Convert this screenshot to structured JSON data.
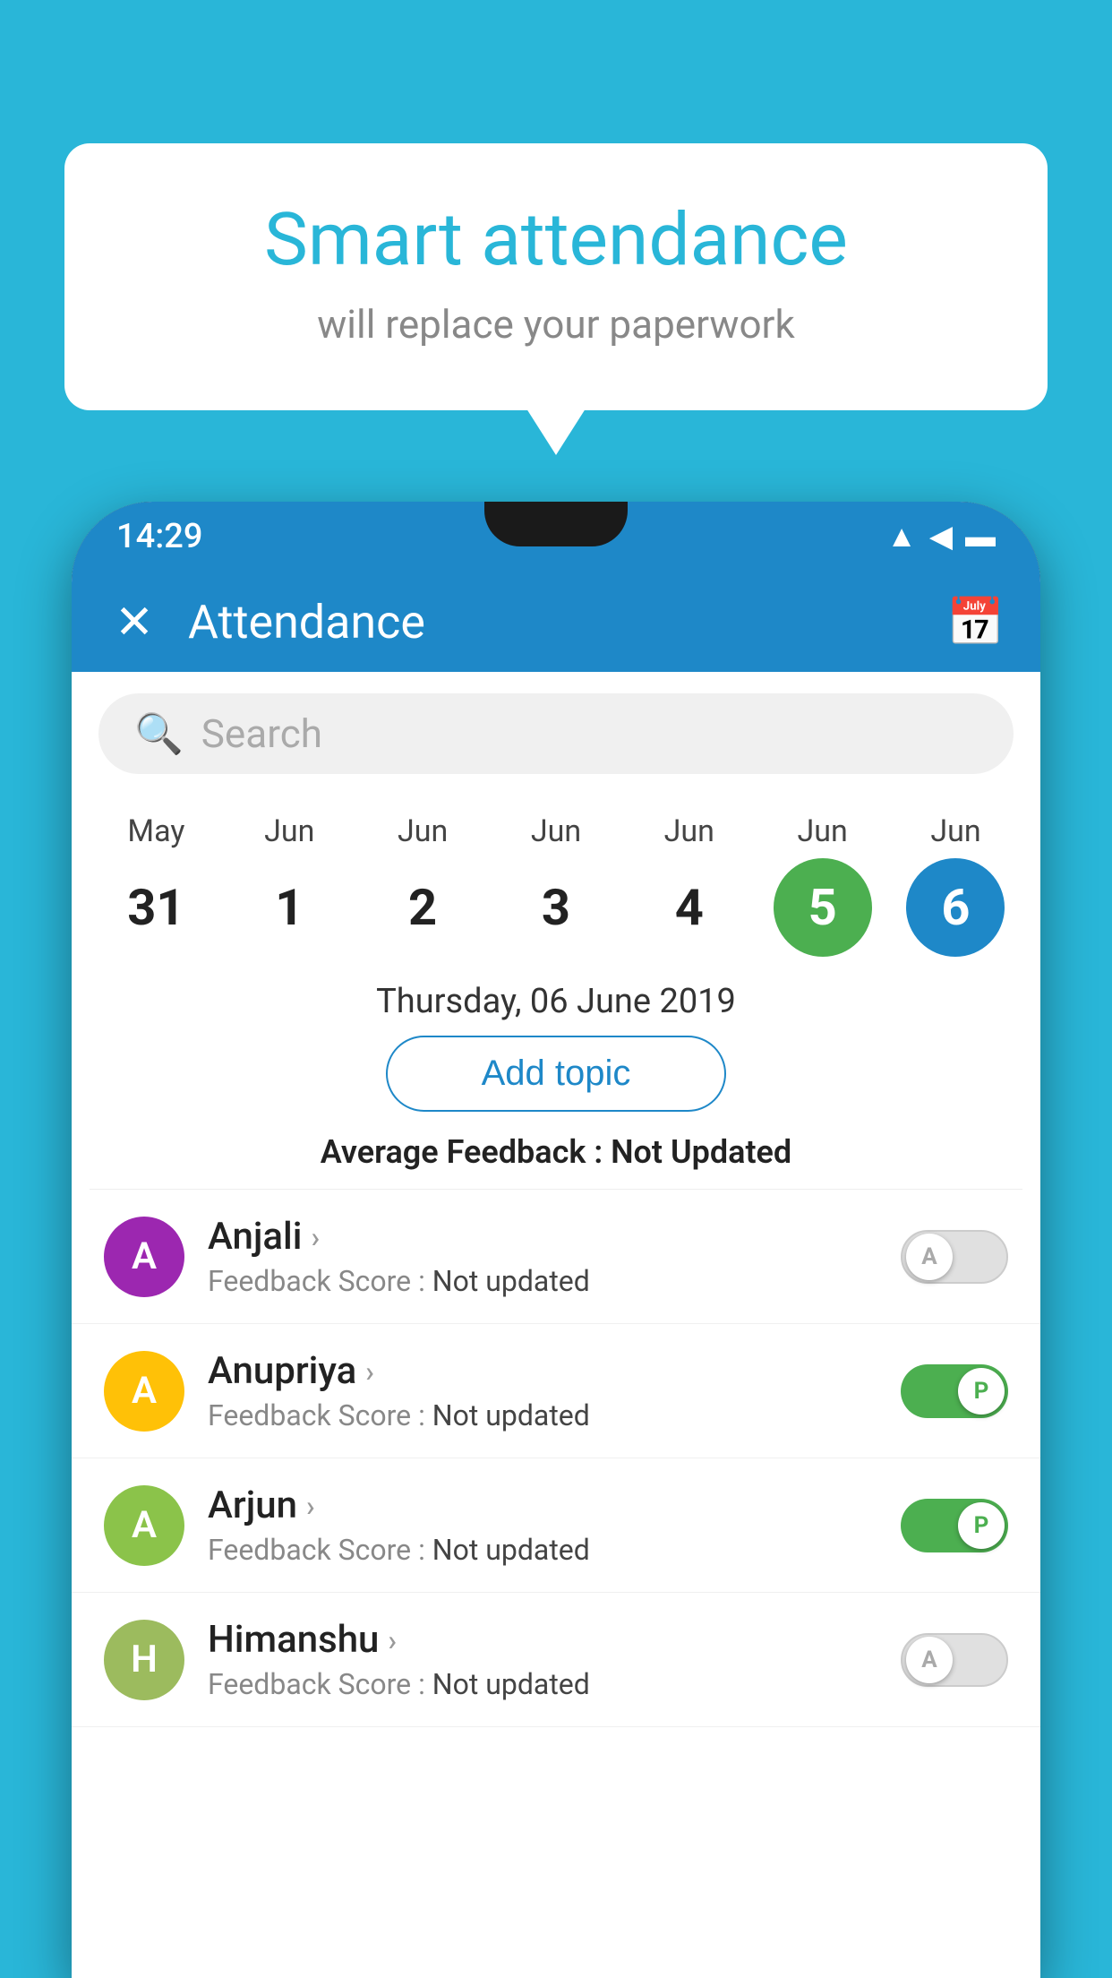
{
  "background_color": "#29b6d8",
  "speech_bubble": {
    "title": "Smart attendance",
    "subtitle": "will replace your paperwork"
  },
  "status_bar": {
    "time": "14:29"
  },
  "app_bar": {
    "title": "Attendance",
    "close_label": "×",
    "calendar_icon": "calendar"
  },
  "search": {
    "placeholder": "Search"
  },
  "calendar": {
    "days": [
      {
        "month": "May",
        "date": "31",
        "style": "normal"
      },
      {
        "month": "Jun",
        "date": "1",
        "style": "normal"
      },
      {
        "month": "Jun",
        "date": "2",
        "style": "normal"
      },
      {
        "month": "Jun",
        "date": "3",
        "style": "normal"
      },
      {
        "month": "Jun",
        "date": "4",
        "style": "normal"
      },
      {
        "month": "Jun",
        "date": "5",
        "style": "green"
      },
      {
        "month": "Jun",
        "date": "6",
        "style": "blue"
      }
    ]
  },
  "selected_date": "Thursday, 06 June 2019",
  "add_topic_label": "Add topic",
  "avg_feedback_label": "Average Feedback :",
  "avg_feedback_value": "Not Updated",
  "students": [
    {
      "name": "Anjali",
      "avatar_letter": "A",
      "avatar_color": "purple",
      "feedback_label": "Feedback Score :",
      "feedback_value": "Not updated",
      "toggle_state": "off",
      "toggle_label": "A"
    },
    {
      "name": "Anupriya",
      "avatar_letter": "A",
      "avatar_color": "yellow",
      "feedback_label": "Feedback Score :",
      "feedback_value": "Not updated",
      "toggle_state": "on",
      "toggle_label": "P"
    },
    {
      "name": "Arjun",
      "avatar_letter": "A",
      "avatar_color": "light-green",
      "feedback_label": "Feedback Score :",
      "feedback_value": "Not updated",
      "toggle_state": "on",
      "toggle_label": "P"
    },
    {
      "name": "Himanshu",
      "avatar_letter": "H",
      "avatar_color": "olive",
      "feedback_label": "Feedback Score :",
      "feedback_value": "Not updated",
      "toggle_state": "off",
      "toggle_label": "A"
    }
  ]
}
